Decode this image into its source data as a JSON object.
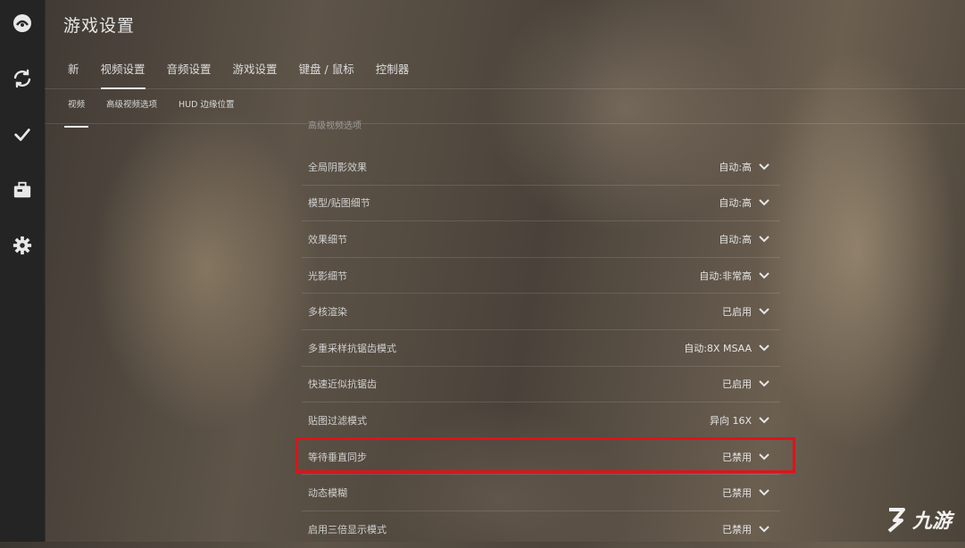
{
  "page": {
    "title": "游戏设置"
  },
  "sidebar": {
    "icons": [
      "home-icon",
      "refresh-icon",
      "checkmark-icon",
      "briefcase-icon",
      "gear-icon"
    ]
  },
  "tabs": [
    {
      "label": "新"
    },
    {
      "label": "视频设置",
      "active": true
    },
    {
      "label": "音频设置"
    },
    {
      "label": "游戏设置"
    },
    {
      "label": "键盘 / 鼠标"
    },
    {
      "label": "控制器"
    }
  ],
  "subtabs": [
    {
      "label": "视频",
      "active": true
    },
    {
      "label": "高级视频选项"
    },
    {
      "label": "HUD 边缘位置"
    }
  ],
  "section_heading": "高级视频选项",
  "settings": [
    {
      "label": "全局阴影效果",
      "value": "自动:高"
    },
    {
      "label": "模型/贴图细节",
      "value": "自动:高"
    },
    {
      "label": "效果细节",
      "value": "自动:高"
    },
    {
      "label": "光影细节",
      "value": "自动:非常高"
    },
    {
      "label": "多核渲染",
      "value": "已启用"
    },
    {
      "label": "多重采样抗锯齿模式",
      "value": "自动:8X MSAA"
    },
    {
      "label": "快速近似抗锯齿",
      "value": "已启用"
    },
    {
      "label": "贴图过滤模式",
      "value": "异向 16X"
    },
    {
      "label": "等待垂直同步",
      "value": "已禁用",
      "highlighted": true
    },
    {
      "label": "动态模糊",
      "value": "已禁用"
    },
    {
      "label": "启用三倍显示模式",
      "value": "已禁用"
    }
  ],
  "highlight_color": "#e0121a",
  "watermark": {
    "text": "九游"
  }
}
